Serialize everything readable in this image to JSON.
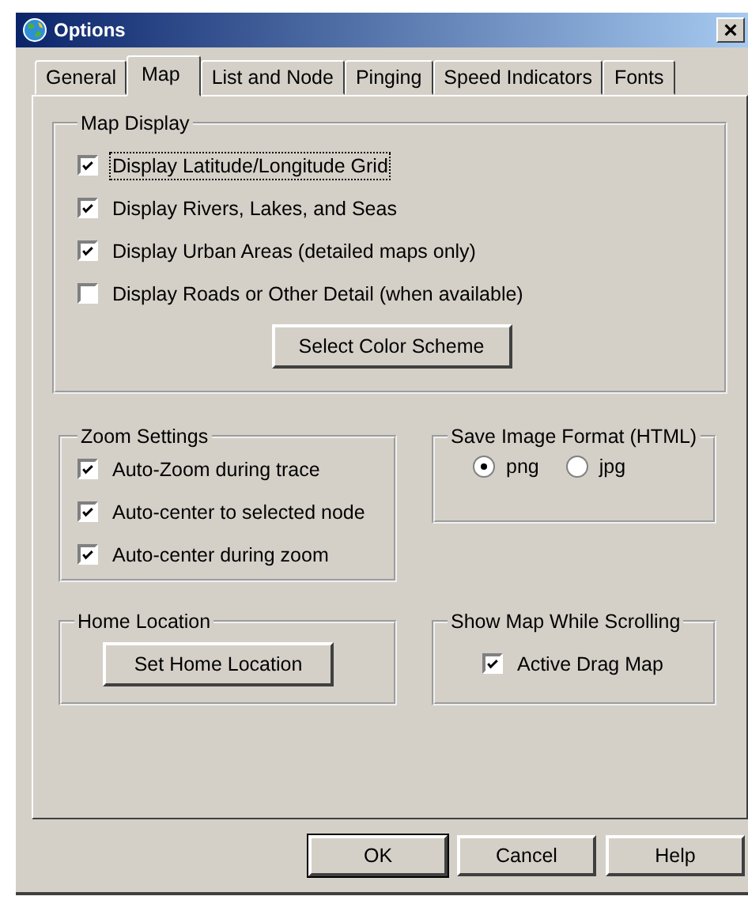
{
  "window": {
    "title": "Options"
  },
  "tabs": [
    {
      "label": "General",
      "selected": false
    },
    {
      "label": "Map",
      "selected": true
    },
    {
      "label": "List and Node",
      "selected": false
    },
    {
      "label": "Pinging",
      "selected": false
    },
    {
      "label": "Speed Indicators",
      "selected": false
    },
    {
      "label": "Fonts",
      "selected": false
    }
  ],
  "map_display": {
    "title": "Map Display",
    "options": [
      {
        "label": "Display Latitude/Longitude Grid",
        "checked": true,
        "focused": true
      },
      {
        "label": "Display Rivers, Lakes, and Seas",
        "checked": true,
        "focused": false
      },
      {
        "label": "Display Urban Areas (detailed maps only)",
        "checked": true,
        "focused": false
      },
      {
        "label": "Display Roads or Other Detail (when available)",
        "checked": false,
        "focused": false
      }
    ],
    "button": "Select Color Scheme"
  },
  "zoom_settings": {
    "title": "Zoom Settings",
    "options": [
      {
        "label": "Auto-Zoom during trace",
        "checked": true
      },
      {
        "label": "Auto-center to selected node",
        "checked": true
      },
      {
        "label": "Auto-center during zoom",
        "checked": true
      }
    ]
  },
  "save_image_format": {
    "title": "Save Image Format (HTML)",
    "options": [
      {
        "label": "png",
        "selected": true
      },
      {
        "label": "jpg",
        "selected": false
      }
    ]
  },
  "home_location": {
    "title": "Home Location",
    "button": "Set Home Location"
  },
  "show_map_while_scrolling": {
    "title": "Show Map While Scrolling",
    "options": [
      {
        "label": "Active Drag Map",
        "checked": true
      }
    ]
  },
  "buttons": [
    {
      "label": "OK",
      "default": true
    },
    {
      "label": "Cancel",
      "default": false
    },
    {
      "label": "Help",
      "default": false
    }
  ]
}
